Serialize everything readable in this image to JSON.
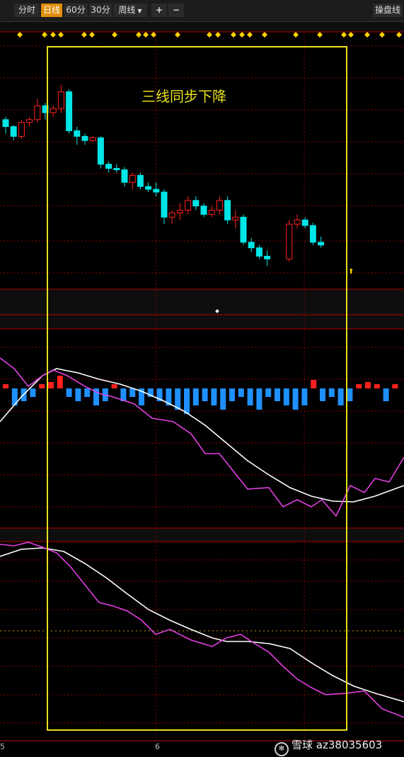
{
  "toolbar": {
    "tabs": [
      {
        "label": "分时",
        "active": false
      },
      {
        "label": "日线",
        "active": true
      },
      {
        "label": "60分",
        "active": false
      },
      {
        "label": "30分",
        "active": false
      },
      {
        "label": "周线",
        "active": false
      }
    ],
    "zoom_in": "+",
    "zoom_out": "−",
    "right_button": "操盘线"
  },
  "annotation": "三线同步下降",
  "x_ticks": [
    "5",
    "6"
  ],
  "watermark": {
    "brand": "雪球",
    "handle": "az38035603"
  },
  "colors": {
    "up": "#ff2020",
    "down": "#00e5e5",
    "grid": "#8b0000",
    "highlight": "#e6e020",
    "line1": "#ffffff",
    "line2": "#e040e0"
  },
  "chart_data": {
    "type": "candlestick",
    "candles": [
      [
        1.6,
        1.62,
        1.5,
        1.55
      ],
      [
        1.55,
        1.56,
        1.45,
        1.48
      ],
      [
        1.48,
        1.6,
        1.46,
        1.58
      ],
      [
        1.58,
        1.62,
        1.55,
        1.6
      ],
      [
        1.6,
        1.75,
        1.58,
        1.7
      ],
      [
        1.7,
        1.72,
        1.6,
        1.65
      ],
      [
        1.65,
        1.7,
        1.62,
        1.68
      ],
      [
        1.68,
        1.85,
        1.65,
        1.8
      ],
      [
        1.8,
        1.82,
        1.5,
        1.52
      ],
      [
        1.52,
        1.55,
        1.42,
        1.48
      ],
      [
        1.48,
        1.5,
        1.42,
        1.45
      ],
      [
        1.45,
        1.48,
        1.44,
        1.47
      ],
      [
        1.47,
        1.48,
        1.25,
        1.28
      ],
      [
        1.28,
        1.3,
        1.22,
        1.25
      ],
      [
        1.25,
        1.28,
        1.22,
        1.24
      ],
      [
        1.24,
        1.26,
        1.12,
        1.15
      ],
      [
        1.15,
        1.22,
        1.1,
        1.2
      ],
      [
        1.2,
        1.22,
        1.1,
        1.12
      ],
      [
        1.12,
        1.15,
        1.08,
        1.1
      ],
      [
        1.1,
        1.15,
        1.05,
        1.08
      ],
      [
        1.08,
        1.1,
        0.85,
        0.9
      ],
      [
        0.9,
        0.95,
        0.85,
        0.93
      ],
      [
        0.93,
        1.0,
        0.88,
        0.95
      ],
      [
        0.95,
        1.05,
        0.92,
        1.02
      ],
      [
        1.02,
        1.05,
        0.95,
        0.98
      ],
      [
        0.98,
        1.0,
        0.9,
        0.92
      ],
      [
        0.92,
        0.98,
        0.9,
        0.95
      ],
      [
        0.95,
        1.05,
        0.92,
        1.02
      ],
      [
        1.02,
        1.05,
        0.85,
        0.88
      ],
      [
        0.88,
        0.95,
        0.82,
        0.9
      ],
      [
        0.9,
        0.92,
        0.7,
        0.72
      ],
      [
        0.72,
        0.75,
        0.65,
        0.68
      ],
      [
        0.68,
        0.7,
        0.6,
        0.62
      ],
      [
        0.62,
        0.66,
        0.55,
        0.6
      ],
      [
        0.6,
        0.88,
        0.58,
        0.85
      ],
      [
        0.85,
        0.92,
        0.82,
        0.88
      ],
      [
        0.88,
        0.9,
        0.82,
        0.84
      ],
      [
        0.84,
        0.86,
        0.7,
        0.72
      ],
      [
        0.72,
        0.76,
        0.68,
        0.7
      ]
    ]
  }
}
